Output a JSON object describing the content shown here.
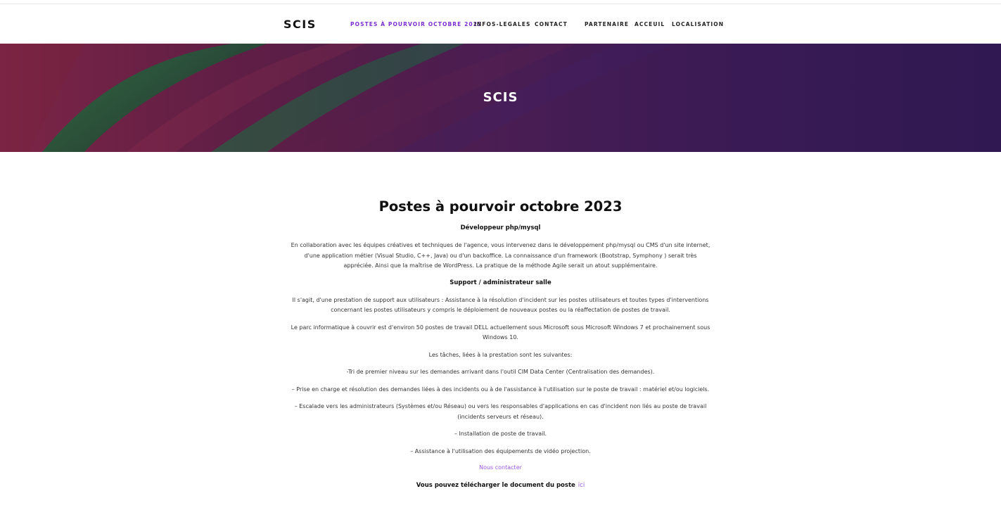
{
  "site": {
    "brand": "SCIS"
  },
  "nav": {
    "items": [
      {
        "label": "POSTES À POURVOIR OCTOBRE 2023",
        "active": true
      },
      {
        "label": "INFOS-LEGALES"
      },
      {
        "label": "CONTACT"
      },
      {
        "label": "PARTENAIRE"
      },
      {
        "label": "ACCEUIL"
      },
      {
        "label": "LOCALISATION"
      }
    ],
    "active_color": "#7b2fd0"
  },
  "hero": {
    "title": "SCIS"
  },
  "page": {
    "title": "Postes à pourvoir octobre 2023",
    "job1": {
      "title": "Développeur php/mysql",
      "description": "En collaboration avec les équipes créatives et techniques de l'agence, vous intervenez dans le développement php/mysql  ou CMS d'un site internet, d'une application métier (Visual Studio, C++, Java) ou d'un backoffice. La connaissance d'un framework (Bootstrap,  Symphony ) serait très appréciée. Ainsi que la maîtrise de WordPress. La pratique de la méthode Agile serait un atout supplémentaire."
    },
    "job2": {
      "title": "Support / administrateur salle",
      "paragraphs": [
        "Il s'agit, d'une prestation de support aux utilisateurs : Assistance à la résolution d'incident sur les postes utilisateurs et toutes types d'interventions concernant les postes utilisateurs y compris le déploiement de nouveaux postes ou la réaffectation de postes de travail.",
        "Le parc informatique à couvrir est d'environ 50 postes de travail DELL actuellement sous Microsoft sous Microsoft Windows 7 et prochainement sous Windows 10.",
        "Les tâches, liées à la prestation sont les suivantes:",
        "-Tri de premier niveau sur les demandes arrivant dans l'outil CIM Data Center (Centralisation des demandes).",
        "– Prise en charge et résolution des demandes liées à des incidents ou à de l'assistance à l'utilisation sur le poste de travail :  matériel et/ou logiciels.",
        "– Escalade vers les administrateurs (Systèmes et/ou Réseau) ou vers les responsables d'applications en cas d'incident non liés au poste de travail (incidents serveurs et réseau).",
        "– Installation de poste de travail.",
        "– Assistance à l'utilisation des équipements de vidéo projection."
      ]
    },
    "contact_link": "Nous contacter",
    "download_text": "Vous pouvez  télécharger le document du poste",
    "download_link": "ici",
    "link_color": "#9b59e6"
  }
}
